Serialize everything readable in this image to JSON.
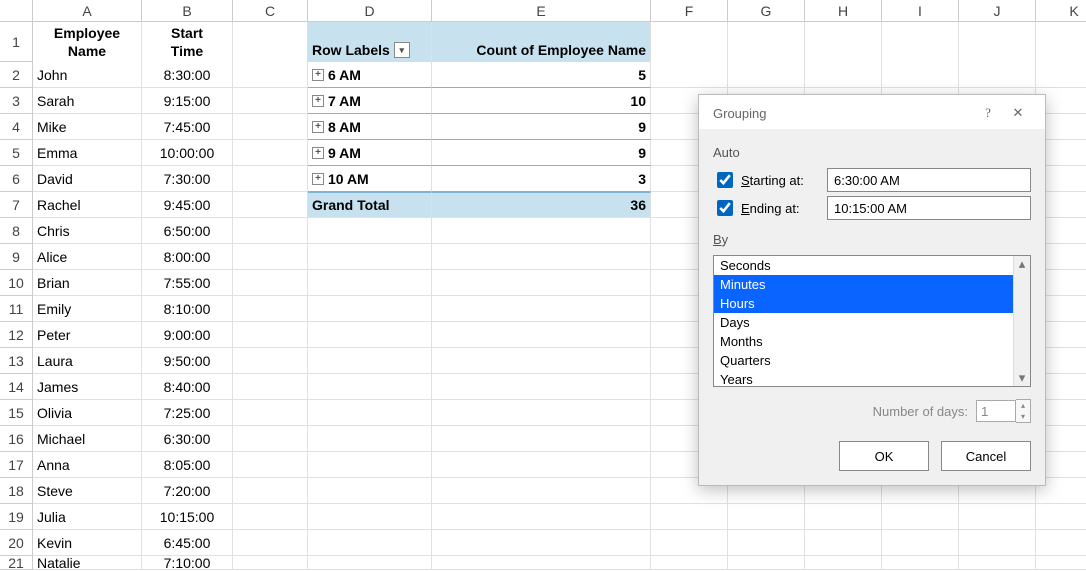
{
  "columns": [
    "A",
    "B",
    "C",
    "D",
    "E",
    "F",
    "G",
    "H",
    "I",
    "J",
    "K"
  ],
  "header": {
    "A1": "Employee",
    "A2": "Name",
    "B1": "Start",
    "B2": "Time"
  },
  "pivot": {
    "row_labels": "Row Labels",
    "count_label": "Count of Employee Name",
    "rows": [
      {
        "label": "6 AM",
        "count": "5"
      },
      {
        "label": "7 AM",
        "count": "10"
      },
      {
        "label": "8 AM",
        "count": "9"
      },
      {
        "label": "9 AM",
        "count": "9"
      },
      {
        "label": "10 AM",
        "count": "3"
      }
    ],
    "grand_total_label": "Grand Total",
    "grand_total_value": "36"
  },
  "data_rows": [
    {
      "n": "2",
      "name": "John",
      "time": "8:30:00"
    },
    {
      "n": "3",
      "name": "Sarah",
      "time": "9:15:00"
    },
    {
      "n": "4",
      "name": "Mike",
      "time": "7:45:00"
    },
    {
      "n": "5",
      "name": "Emma",
      "time": "10:00:00"
    },
    {
      "n": "6",
      "name": "David",
      "time": "7:30:00"
    },
    {
      "n": "7",
      "name": "Rachel",
      "time": "9:45:00"
    },
    {
      "n": "8",
      "name": "Chris",
      "time": "6:50:00"
    },
    {
      "n": "9",
      "name": "Alice",
      "time": "8:00:00"
    },
    {
      "n": "10",
      "name": "Brian",
      "time": "7:55:00"
    },
    {
      "n": "11",
      "name": "Emily",
      "time": "8:10:00"
    },
    {
      "n": "12",
      "name": "Peter",
      "time": "9:00:00"
    },
    {
      "n": "13",
      "name": "Laura",
      "time": "9:50:00"
    },
    {
      "n": "14",
      "name": "James",
      "time": "8:40:00"
    },
    {
      "n": "15",
      "name": "Olivia",
      "time": "7:25:00"
    },
    {
      "n": "16",
      "name": "Michael",
      "time": "6:30:00"
    },
    {
      "n": "17",
      "name": "Anna",
      "time": "8:05:00"
    },
    {
      "n": "18",
      "name": "Steve",
      "time": "7:20:00"
    },
    {
      "n": "19",
      "name": "Julia",
      "time": "10:15:00"
    },
    {
      "n": "20",
      "name": "Kevin",
      "time": "6:45:00"
    },
    {
      "n": "21",
      "name": "Natalie",
      "time": "7:10:00"
    }
  ],
  "dialog": {
    "title": "Grouping",
    "auto_label": "Auto",
    "starting_label": "Starting at:",
    "starting_value": "6:30:00 AM",
    "ending_label": "Ending at:",
    "ending_value": "10:15:00 AM",
    "by_label": "By",
    "by_options": [
      "Seconds",
      "Minutes",
      "Hours",
      "Days",
      "Months",
      "Quarters",
      "Years"
    ],
    "by_selected": [
      "Minutes",
      "Hours"
    ],
    "numdays_label": "Number of days:",
    "numdays_value": "1",
    "ok": "OK",
    "cancel": "Cancel"
  }
}
